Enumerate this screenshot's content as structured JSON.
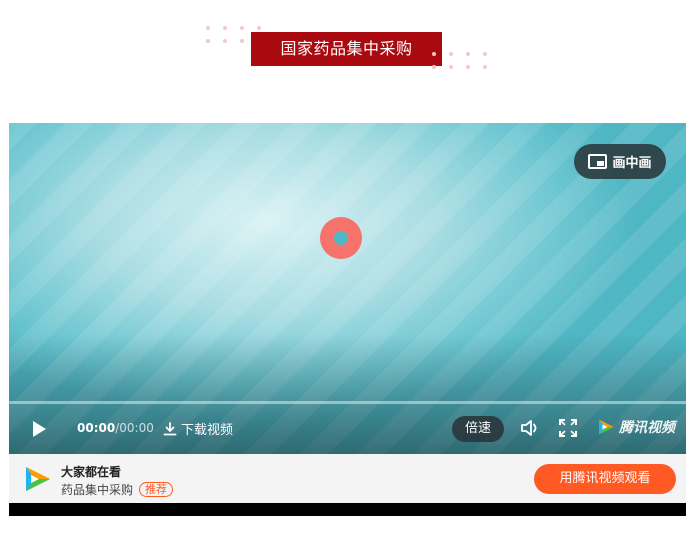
{
  "header": {
    "title": "国家药品集中采购"
  },
  "player": {
    "pip_label": "画中画",
    "time_current": "00:00",
    "time_separator": "/",
    "time_total": "00:00",
    "download_label": "下载视频",
    "speed_label": "倍速",
    "brand_name": "腾讯视频"
  },
  "promo": {
    "title": "大家都在看",
    "subtitle": "药品集中采购",
    "tag": "推荐",
    "button_label": "用腾讯视频观看"
  },
  "colors": {
    "banner": "#a90a10",
    "accent": "#ff5a24",
    "spinner": "#f5736a"
  },
  "icons": [
    "pip-icon",
    "play-icon",
    "download-icon",
    "volume-icon",
    "fullscreen-icon",
    "tencent-video-logo-icon"
  ]
}
